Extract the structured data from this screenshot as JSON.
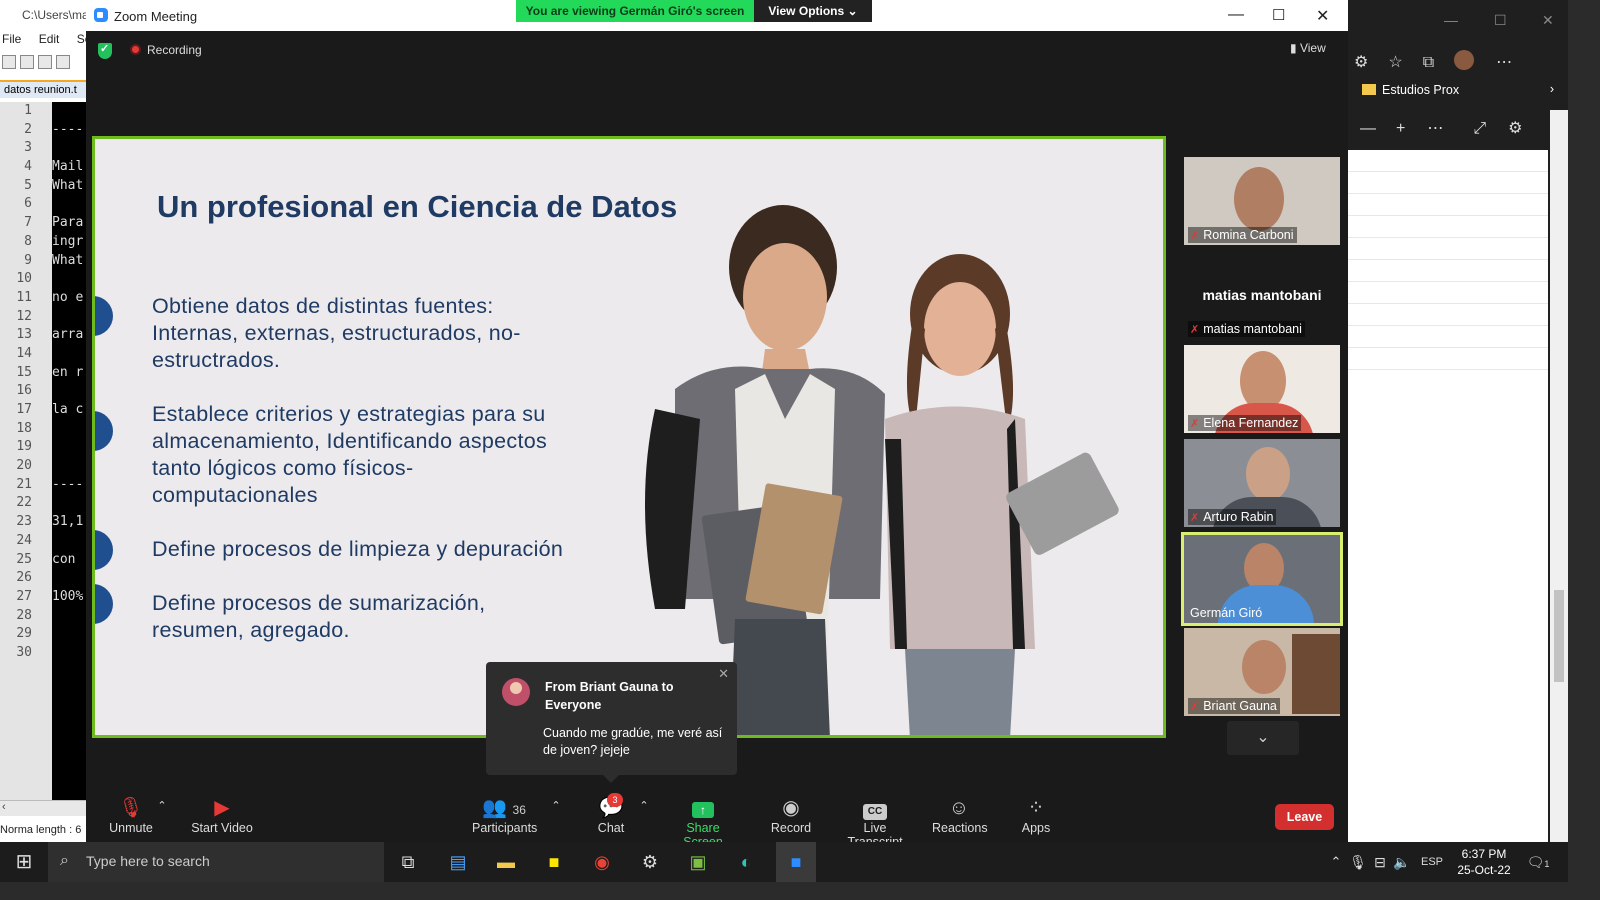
{
  "notepad": {
    "path": "C:\\Users\\ma",
    "menu": [
      "File",
      "Edit",
      "Sea"
    ],
    "tab": "datos reunion.t",
    "lines": [
      "1",
      "2",
      "3",
      "4",
      "5",
      "6",
      "7",
      "8",
      "9",
      "10",
      "11",
      "12",
      "13",
      "14",
      "15",
      "16",
      "17",
      "18",
      "19",
      "20",
      "21",
      "22",
      "23",
      "24",
      "25",
      "26",
      "27",
      "28",
      "29",
      "30"
    ],
    "code": [
      "",
      "----",
      "",
      "Mail",
      "What",
      "",
      "Para",
      "ingr",
      "What",
      "",
      "no e",
      "",
      "arra",
      "",
      "en r",
      "",
      "la c",
      "",
      "",
      "",
      "----",
      "",
      "31,1",
      "",
      "con ",
      "",
      "100%",
      "",
      "",
      ""
    ],
    "status": "Norma length : 6"
  },
  "zoom": {
    "title": "Zoom Meeting",
    "viewing_banner": "You are viewing Germán Giró's screen",
    "view_options": "View Options",
    "recording": "Recording",
    "view": "View",
    "slide": {
      "title": "Un profesional en Ciencia de Datos",
      "bullets": [
        [
          "Obtiene datos de distintas fuentes:",
          "Internas, externas, estructurados, no-",
          "estructrados."
        ],
        [
          "Establece criterios y estrategias para su",
          "almacenamiento, Identificando aspectos",
          "tanto lógicos como físicos-",
          "computacionales"
        ],
        [
          "Define procesos de limpieza y depuración"
        ],
        [
          "Define procesos de sumarización,",
          "resumen, agregado."
        ]
      ]
    },
    "chat_popup": {
      "from": "From Briant Gauna to Everyone",
      "message": "Cuando me gradúe, me veré así de joven? jejeje"
    },
    "participants_tiles": [
      {
        "name": "Romina Carboni"
      },
      {
        "name": "matias mantobani",
        "display": "matias mantobani"
      },
      {
        "name": "Elena Fernandez"
      },
      {
        "name": "Arturo Rabin"
      },
      {
        "name": "Germán Giró",
        "active": true
      },
      {
        "name": "Briant Gauna"
      }
    ],
    "toolbar": {
      "unmute": "Unmute",
      "start_video": "Start Video",
      "participants": "Participants",
      "participants_count": "36",
      "chat": "Chat",
      "chat_badge": "3",
      "share_screen": "Share Screen",
      "record": "Record",
      "live_transcript": "Live Transcript",
      "reactions": "Reactions",
      "apps": "Apps",
      "leave": "Leave"
    }
  },
  "edge": {
    "favorite_folder": "Estudios Prox"
  },
  "taskbar": {
    "search_placeholder": "Type here to search",
    "language": "ESP",
    "time": "6:37 PM",
    "date": "25-Oct-22",
    "notification_count": "1"
  },
  "colors": {
    "zoom_green": "#23d959",
    "slide_blue": "#1f3a63",
    "speaker_border": "#6dbb1f",
    "leave_red": "#d32f2f"
  }
}
